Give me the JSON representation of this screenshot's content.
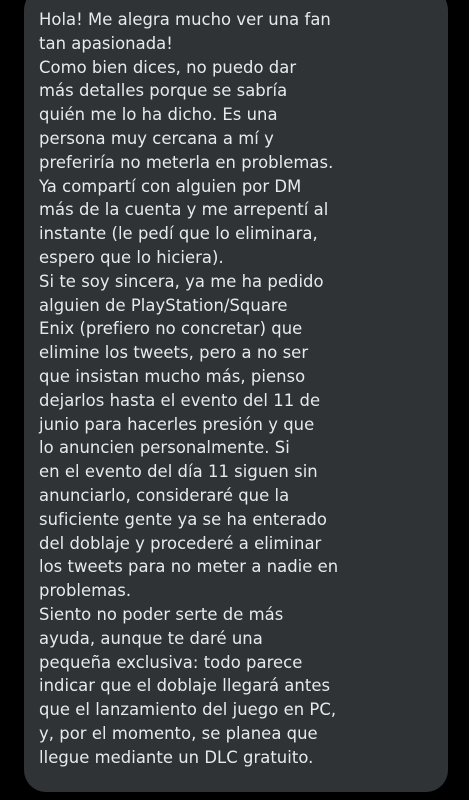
{
  "message": {
    "lines": [
      "Hola! Me alegra mucho ver una fan",
      "tan apasionada!",
      "Como bien dices, no puedo dar",
      "más detalles porque se sabría",
      "quién me lo ha dicho. Es una",
      "persona muy cercana a mí y",
      "preferiría no meterla en problemas.",
      "Ya compartí con alguien por DM",
      "más de la cuenta y me arrepentí al",
      "instante (le pedí que lo eliminara,",
      "espero que lo hiciera).",
      "Si te soy sincera, ya me ha pedido",
      "alguien de PlayStation/Square",
      "Enix (prefiero no concretar) que",
      "elimine los tweets, pero a no ser",
      "que insistan mucho más, pienso",
      "dejarlos hasta el evento del 11 de",
      "junio para hacerles presión y que",
      "lo anuncien personalmente. Si",
      "en el evento del día 11 siguen sin",
      "anunciarlo, consideraré que la",
      "suficiente gente ya se ha enterado",
      "del doblaje y procederé a eliminar",
      "los tweets para no meter a nadie en",
      "problemas.",
      "Siento no poder serte de más",
      "ayuda, aunque te daré una",
      "pequeña exclusiva: todo parece",
      "indicar que el doblaje llegará antes",
      "que el lanzamiento del juego en PC,",
      "y, por el momento, se planea que",
      "llegue mediante un DLC gratuito."
    ],
    "bubble_color": "#2f3336",
    "text_color": "#e7e9ea",
    "background_color": "#000000"
  }
}
